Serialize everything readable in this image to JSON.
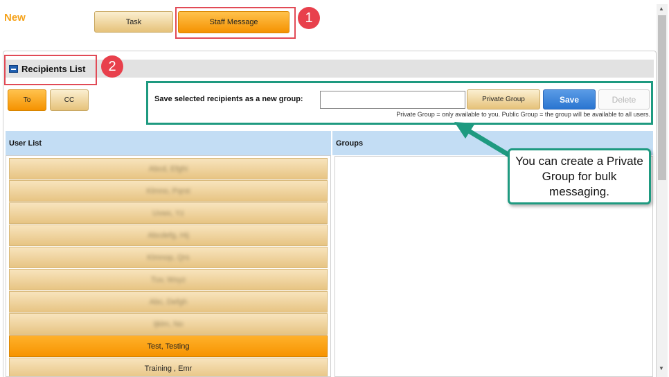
{
  "header": {
    "title": "New",
    "task_label": "Task",
    "staff_message_label": "Staff Message"
  },
  "annotations": {
    "badge1": "1",
    "badge2": "2",
    "callout": "You can create a Private Group for bulk messaging."
  },
  "recipients": {
    "title": "Recipients List",
    "to_label": "To",
    "cc_label": "CC"
  },
  "group_form": {
    "label": "Save selected recipients as a new group:",
    "input_value": "",
    "private_group_label": "Private Group",
    "save_label": "Save",
    "delete_label": "Delete",
    "help_text": "Private Group = only available to you.  Public Group = the group will be available to all users."
  },
  "columns": {
    "user_list": "User List",
    "groups": "Groups"
  },
  "users": [
    {
      "name": "Abcd, Efghi",
      "selected": false,
      "blurred": true
    },
    {
      "name": "Klmno, Pqrst",
      "selected": false,
      "blurred": true
    },
    {
      "name": "Uvwx, Yz",
      "selected": false,
      "blurred": true
    },
    {
      "name": "Abcdefg, Hij",
      "selected": false,
      "blurred": true
    },
    {
      "name": "Klmnop, Qrs",
      "selected": false,
      "blurred": true
    },
    {
      "name": "Tuv, Wxyz",
      "selected": false,
      "blurred": true
    },
    {
      "name": "Abc, Defgh",
      "selected": false,
      "blurred": true
    },
    {
      "name": "Ijklm, No",
      "selected": false,
      "blurred": true
    },
    {
      "name": "Test, Testing",
      "selected": true,
      "blurred": false
    },
    {
      "name": "Training , Emr",
      "selected": false,
      "blurred": false
    }
  ],
  "colors": {
    "accent_orange": "#f59200",
    "annotation_red": "#e8404c",
    "annotation_teal": "#1e9a80",
    "save_blue": "#2a75d0",
    "column_header": "#c3ddf4"
  }
}
